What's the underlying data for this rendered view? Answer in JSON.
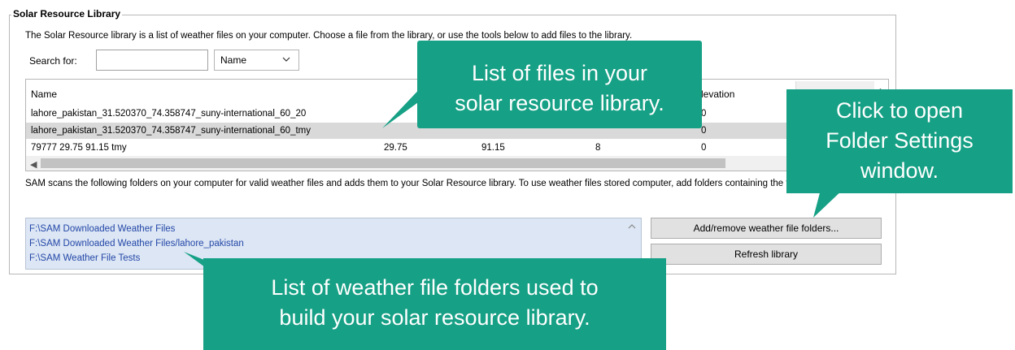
{
  "group": {
    "title": "Solar Resource Library"
  },
  "description": "The Solar Resource library is a list of weather files on your computer. Choose a file from the library, or use the tools below to add files to the library.",
  "search": {
    "label": "Search for:",
    "value": "",
    "select_value": "Name"
  },
  "list": {
    "columns": [
      "Name",
      "Elevation"
    ],
    "rows": [
      {
        "name": "lahore_pakistan_31.520370_74.358747_suny-international_60_20",
        "c2": "",
        "c3": "",
        "c4": "",
        "c5": "0",
        "selected": false
      },
      {
        "name": "lahore_pakistan_31.520370_74.358747_suny-international_60_tmy",
        "c2": "",
        "c3": "",
        "c4": "",
        "c5": "0",
        "selected": true
      },
      {
        "name": "79777 29.75 91.15 tmy",
        "c2": "29.75",
        "c3": "91.15",
        "c4": "8",
        "c5": "0",
        "selected": false
      }
    ]
  },
  "scan_description": "SAM scans the following folders on your computer for valid weather files and adds them to your Solar Resource library. To use weather files stored computer, add folders containing the files.",
  "folders": [
    "F:\\SAM Downloaded Weather Files",
    "F:\\SAM Downloaded Weather Files/lahore_pakistan",
    "F:\\SAM Weather File Tests"
  ],
  "buttons": {
    "add_remove": "Add/remove weather file folders...",
    "refresh": "Refresh library"
  },
  "callouts": {
    "files": [
      "List of files in your",
      "solar resource library."
    ],
    "folder_settings": [
      "Click to open",
      "Folder Settings",
      "window."
    ],
    "folders": [
      "List of weather file folders used to",
      "build your solar resource library."
    ]
  },
  "colors": {
    "callout": "#16a085",
    "folder_text": "#2447a8",
    "folder_bg": "#dce6f4"
  }
}
